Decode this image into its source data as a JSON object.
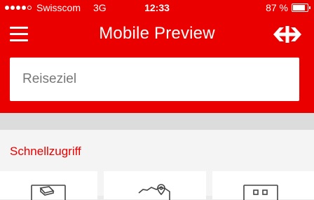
{
  "status_bar": {
    "carrier": "Swisscom",
    "network": "3G",
    "time": "12:33",
    "battery": "87 %",
    "battery_level": 0.87,
    "signal_bars_filled": 4,
    "signal_bars_total": 5
  },
  "header": {
    "title": "Mobile Preview",
    "menu_icon": "hamburger-menu-icon",
    "logo_icon": "sbb-logo-icon"
  },
  "search": {
    "placeholder": "Reiseziel",
    "value": ""
  },
  "quick_access": {
    "title": "Schnellzugriff",
    "tiles": [
      {
        "icon": "ticket-icon"
      },
      {
        "icon": "map-location-icon"
      },
      {
        "icon": "timetable-icon"
      }
    ]
  },
  "colors": {
    "brand_red": "#eb0000",
    "background": "#f4f4f4",
    "divider": "#dcdcdc"
  }
}
